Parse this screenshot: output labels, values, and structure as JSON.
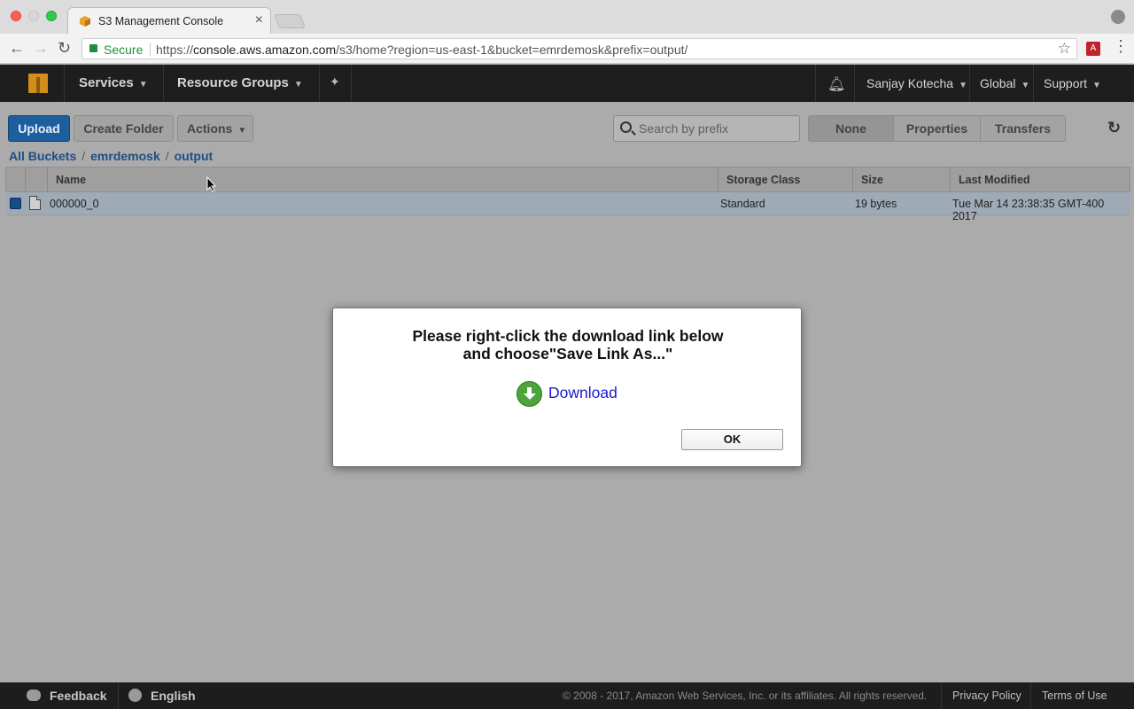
{
  "browser": {
    "tab_title": "S3 Management Console",
    "secure_label": "Secure",
    "url_scheme": "https://",
    "url_host": "console.aws.amazon.com",
    "url_path": "/s3/home?region=us-east-1&bucket=emrdemosk&prefix=output/"
  },
  "aws_nav": {
    "services": "Services",
    "resource_groups": "Resource Groups",
    "user": "Sanjay Kotecha",
    "region": "Global",
    "support": "Support"
  },
  "toolbar": {
    "upload": "Upload",
    "create_folder": "Create Folder",
    "actions": "Actions",
    "search_placeholder": "Search by prefix",
    "view_none": "None",
    "view_properties": "Properties",
    "view_transfers": "Transfers"
  },
  "breadcrumb": {
    "root": "All Buckets",
    "bucket": "emrdemosk",
    "folder": "output"
  },
  "table": {
    "columns": {
      "name": "Name",
      "storage_class": "Storage Class",
      "size": "Size",
      "last_modified": "Last Modified"
    },
    "rows": [
      {
        "name": "000000_0",
        "storage_class": "Standard",
        "size": "19 bytes",
        "last_modified": "Tue Mar 14 23:38:35 GMT-400 2017"
      }
    ]
  },
  "modal": {
    "line1": "Please right-click the download link below",
    "line2": "and choose\"Save Link As...\"",
    "download_link": "Download",
    "ok": "OK"
  },
  "footer": {
    "feedback": "Feedback",
    "language": "English",
    "copyright": "© 2008 - 2017, Amazon Web Services, Inc. or its affiliates. All rights reserved.",
    "privacy": "Privacy Policy",
    "terms": "Terms of Use"
  }
}
